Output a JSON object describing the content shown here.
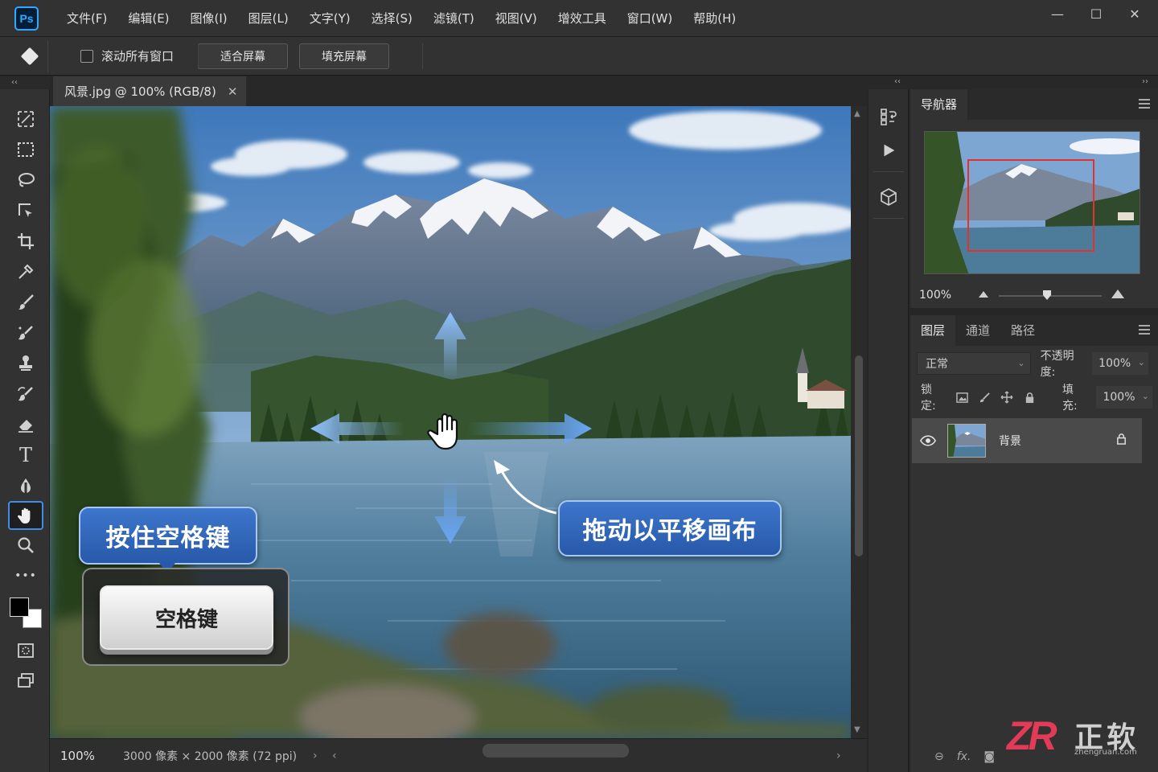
{
  "app": {
    "logo": "Ps",
    "menu": [
      "文件(F)",
      "编辑(E)",
      "图像(I)",
      "图层(L)",
      "文字(Y)",
      "选择(S)",
      "滤镜(T)",
      "视图(V)",
      "增效工具",
      "窗口(W)",
      "帮助(H)"
    ],
    "window_controls": {
      "minimize": "—",
      "maximize": "☐",
      "close": "✕"
    }
  },
  "options_bar": {
    "tool_icon": "hand-preset-icon",
    "scroll_all_label": "滚动所有窗口",
    "scroll_all_checked": false,
    "fit_screen_label": "适合屏幕",
    "fill_screen_label": "填充屏幕"
  },
  "document": {
    "tab_title": "风景.jpg @ 100% (RGB/8)",
    "tab_close": "✕"
  },
  "tools": [
    {
      "name": "artboard-tool-icon",
      "active": false
    },
    {
      "name": "marquee-tool-icon",
      "active": false
    },
    {
      "name": "lasso-tool-icon",
      "active": false
    },
    {
      "name": "object-select-tool-icon",
      "active": false
    },
    {
      "name": "crop-tool-icon",
      "active": false
    },
    {
      "name": "eyedropper-tool-icon",
      "active": false
    },
    {
      "name": "brush-tool-icon",
      "active": false
    },
    {
      "name": "healing-brush-tool-icon",
      "active": false
    },
    {
      "name": "stamp-tool-icon",
      "active": false
    },
    {
      "name": "history-brush-tool-icon",
      "active": false
    },
    {
      "name": "eraser-tool-icon",
      "active": false
    },
    {
      "name": "type-tool-icon",
      "active": false
    },
    {
      "name": "blur-tool-icon",
      "active": false
    },
    {
      "name": "hand-tool-icon",
      "active": true
    },
    {
      "name": "zoom-tool-icon",
      "active": false
    },
    {
      "name": "more-tools-icon",
      "active": false
    }
  ],
  "tool_type_glyph": "T",
  "tool_more_glyph": "•••",
  "canvas_overlay": {
    "hold_space_label": "按住空格键",
    "space_key_label": "空格键",
    "drag_pan_label": "拖动以平移画布"
  },
  "status": {
    "zoom": "100%",
    "dimensions": "3000 像素 × 2000 像素 (72 ppi)",
    "chevron_right": "›",
    "scroll_left": "‹",
    "scroll_right": "›"
  },
  "navigator": {
    "tab_label": "导航器",
    "zoom": "100%"
  },
  "layers": {
    "tabs": [
      "图层",
      "通道",
      "路径"
    ],
    "blend_mode": "正常",
    "opacity_label": "不透明度:",
    "opacity_value": "100%",
    "lock_label": "锁定:",
    "fill_label": "填充:",
    "fill_value": "100%",
    "items": [
      {
        "name": "背景",
        "visible": true,
        "locked": true
      }
    ],
    "bottom_fx": "fx."
  },
  "watermark": {
    "logo": "ZR",
    "name": "正软",
    "url": "zhengruan.com"
  },
  "colors": {
    "accent": "#3d8ee6",
    "callout_blue": "#2f66b8",
    "nav_frame": "#e2312f",
    "panel_bg": "#323232"
  }
}
